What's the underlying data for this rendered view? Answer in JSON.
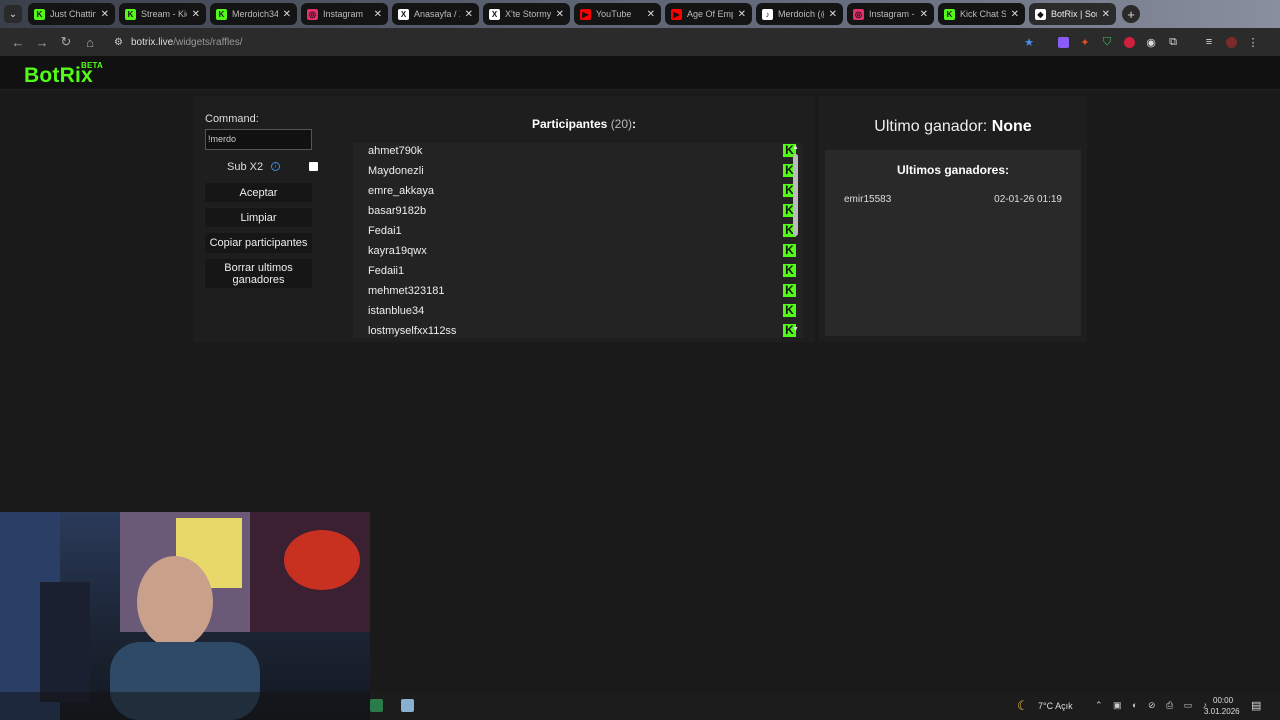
{
  "browser": {
    "tabs": [
      {
        "title": "Just Chatting",
        "icon": "kick-icon",
        "color": "#53fc18",
        "glyph": "K"
      },
      {
        "title": "Stream - Kick",
        "icon": "kick-icon",
        "color": "#53fc18",
        "glyph": "K"
      },
      {
        "title": "Merdoich34",
        "icon": "kick-icon",
        "color": "#53fc18",
        "glyph": "K"
      },
      {
        "title": "Instagram",
        "icon": "instagram-icon",
        "color": "#e1306c",
        "glyph": "◎"
      },
      {
        "title": "Anasayfa / X",
        "icon": "x-icon",
        "color": "#ffffff",
        "glyph": "X"
      },
      {
        "title": "X'te Stormy",
        "icon": "x-icon",
        "color": "#ffffff",
        "glyph": "X"
      },
      {
        "title": "YouTube",
        "icon": "youtube-icon",
        "color": "#ff0000",
        "glyph": "▶"
      },
      {
        "title": "Age Of Empires",
        "icon": "youtube-icon",
        "color": "#ff0000",
        "glyph": "▶"
      },
      {
        "title": "Merdoich (@",
        "icon": "tiktok-icon",
        "color": "#ffffff",
        "glyph": "♪"
      },
      {
        "title": "Instagram -",
        "icon": "instagram-icon",
        "color": "#e1306c",
        "glyph": "◎"
      },
      {
        "title": "Kick Chat Se",
        "icon": "kick-chat-icon",
        "color": "#53fc18",
        "glyph": "K"
      },
      {
        "title": "BotRix | Sor",
        "icon": "botrix-icon",
        "color": "#ffffff",
        "glyph": "◆"
      }
    ],
    "url_host": "botrix.live",
    "url_path": "/widgets/raffles/"
  },
  "site": {
    "logo": "BotRix",
    "logo_tag": "BETA"
  },
  "controls": {
    "command_label": "Command:",
    "command_value": "!merdo",
    "sub_x2_label": "Sub X2",
    "accept": "Aceptar",
    "clear": "Limpiar",
    "copy": "Copiar participantes",
    "delete_winners": "Borrar ultimos ganadores"
  },
  "participants": {
    "title": "Participantes",
    "count": "(20)",
    "colon": ":",
    "items": [
      "ahmet790k",
      "Maydonezli",
      "emre_akkaya",
      "basar9182b",
      "Fedai1",
      "kayra19qwx",
      "Fedaii1",
      "mehmet323181",
      "istanblue34",
      "lostmyselfxx112ss"
    ]
  },
  "winner": {
    "label": "Ultimo ganador:",
    "value": "None",
    "history_title": "Ultimos ganadores:",
    "history": [
      {
        "name": "emir15583",
        "date": "02-01-26 01:19"
      }
    ]
  },
  "taskbar": {
    "weather": "7°C Açık",
    "time": "00:00",
    "date": "3.01.2026"
  },
  "colors": {
    "kick_green": "#53fc18",
    "panel": "#1e1e1e",
    "background": "#1a1a1a"
  }
}
